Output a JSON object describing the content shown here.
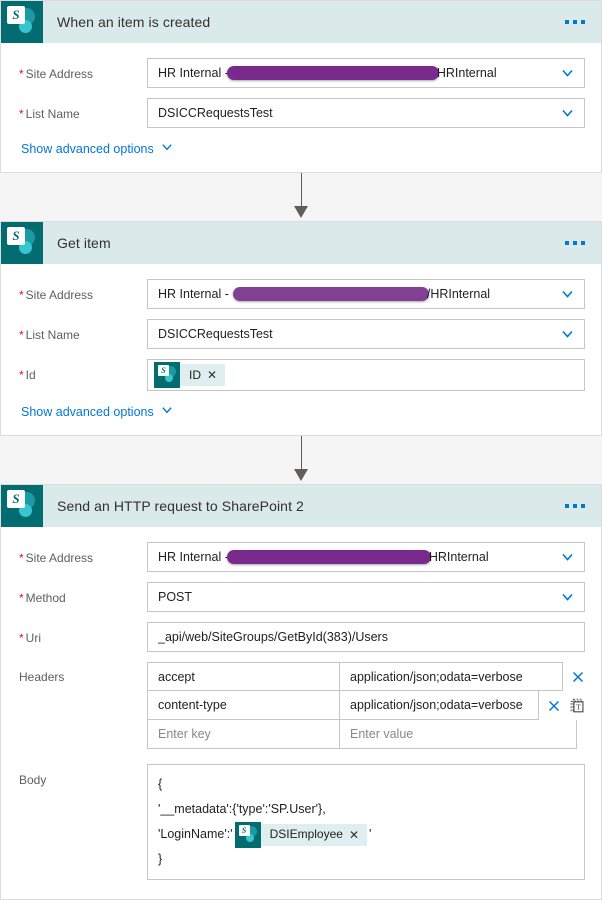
{
  "meta": {
    "accent_blue": "#0078d4",
    "sharepoint_teal": "#036c70",
    "header_band": "#dae9e9",
    "redaction_purple": "#7a2a8c",
    "required_red": "#e81123",
    "canvas_bg": "#f5f5f5"
  },
  "cards": [
    {
      "id": "when-an-item-is-created",
      "title": "When an item is created",
      "icon": "sharepoint-icon",
      "menu_icon": "ellipsis-icon",
      "fields": [
        {
          "name": "site-address",
          "label": "Site Address",
          "required": true,
          "type": "dropdown",
          "value_prefix": "HR Internal -",
          "value_redacted": true,
          "redaction_style": "opaque",
          "value_suffix": "HRInternal",
          "chevron": "chevron-down-icon"
        },
        {
          "name": "list-name",
          "label": "List Name",
          "required": true,
          "type": "dropdown",
          "value": "DSICCRequestsTest",
          "chevron": "chevron-down-icon"
        }
      ],
      "advanced_options": {
        "label": "Show advanced options",
        "chevron": "chevron-down-icon"
      }
    },
    {
      "id": "get-item",
      "title": "Get item",
      "icon": "sharepoint-icon",
      "menu_icon": "ellipsis-icon",
      "fields": [
        {
          "name": "site-address",
          "label": "Site Address",
          "required": true,
          "type": "dropdown",
          "value_prefix": "HR Internal -",
          "value_redacted": true,
          "redaction_style": "soft",
          "value_suffix": "/HRInternal",
          "chevron": "chevron-down-icon"
        },
        {
          "name": "list-name",
          "label": "List Name",
          "required": true,
          "type": "dropdown",
          "value": "DSICCRequestsTest",
          "chevron": "chevron-down-icon"
        },
        {
          "name": "id",
          "label": "Id",
          "required": true,
          "type": "token",
          "token": {
            "icon": "sharepoint-icon",
            "label": "ID",
            "remove_icon": "close-icon"
          }
        }
      ],
      "advanced_options": {
        "label": "Show advanced options",
        "chevron": "chevron-down-icon"
      }
    },
    {
      "id": "send-an-http-request-to-sharepoint-2",
      "title": "Send an HTTP request to SharePoint 2",
      "icon": "sharepoint-icon",
      "menu_icon": "ellipsis-icon",
      "fields": [
        {
          "name": "site-address",
          "label": "Site Address",
          "required": true,
          "type": "dropdown",
          "value_prefix": "HR Internal -",
          "value_redacted": true,
          "redaction_style": "opaque",
          "value_suffix": "HRInternal",
          "chevron": "chevron-down-icon"
        },
        {
          "name": "method",
          "label": "Method",
          "required": true,
          "type": "dropdown",
          "value": "POST",
          "chevron": "chevron-down-icon"
        },
        {
          "name": "uri",
          "label": "Uri",
          "required": true,
          "type": "text",
          "value": "_api/web/SiteGroups/GetById(383)/Users"
        },
        {
          "name": "headers",
          "label": "Headers",
          "required": false,
          "type": "keyvalue-grid",
          "columns": [
            "key",
            "value"
          ],
          "rows": [
            {
              "key": "accept",
              "value": "application/json;odata=verbose",
              "placeholder": false,
              "delete_icon": "close-icon",
              "text_mode_icon": null
            },
            {
              "key": "content-type",
              "value": "application/json;odata=verbose",
              "placeholder": false,
              "delete_icon": "close-icon",
              "text_mode_icon": "switch-to-text-mode-icon"
            },
            {
              "key": "Enter key",
              "value": "Enter value",
              "placeholder": true,
              "delete_icon": null,
              "text_mode_icon": null
            }
          ]
        },
        {
          "name": "body",
          "label": "Body",
          "required": false,
          "type": "code-editor",
          "lines": [
            {
              "text": "{",
              "token": null
            },
            {
              "text": "'__metadata':{'type':'SP.User'},",
              "token": null
            },
            {
              "text_before": "'LoginName':'",
              "token": {
                "icon": "sharepoint-icon",
                "label": "DSIEmployee",
                "remove_icon": "close-icon"
              },
              "text_after": "'"
            },
            {
              "text": "}",
              "token": null
            }
          ]
        }
      ]
    }
  ]
}
